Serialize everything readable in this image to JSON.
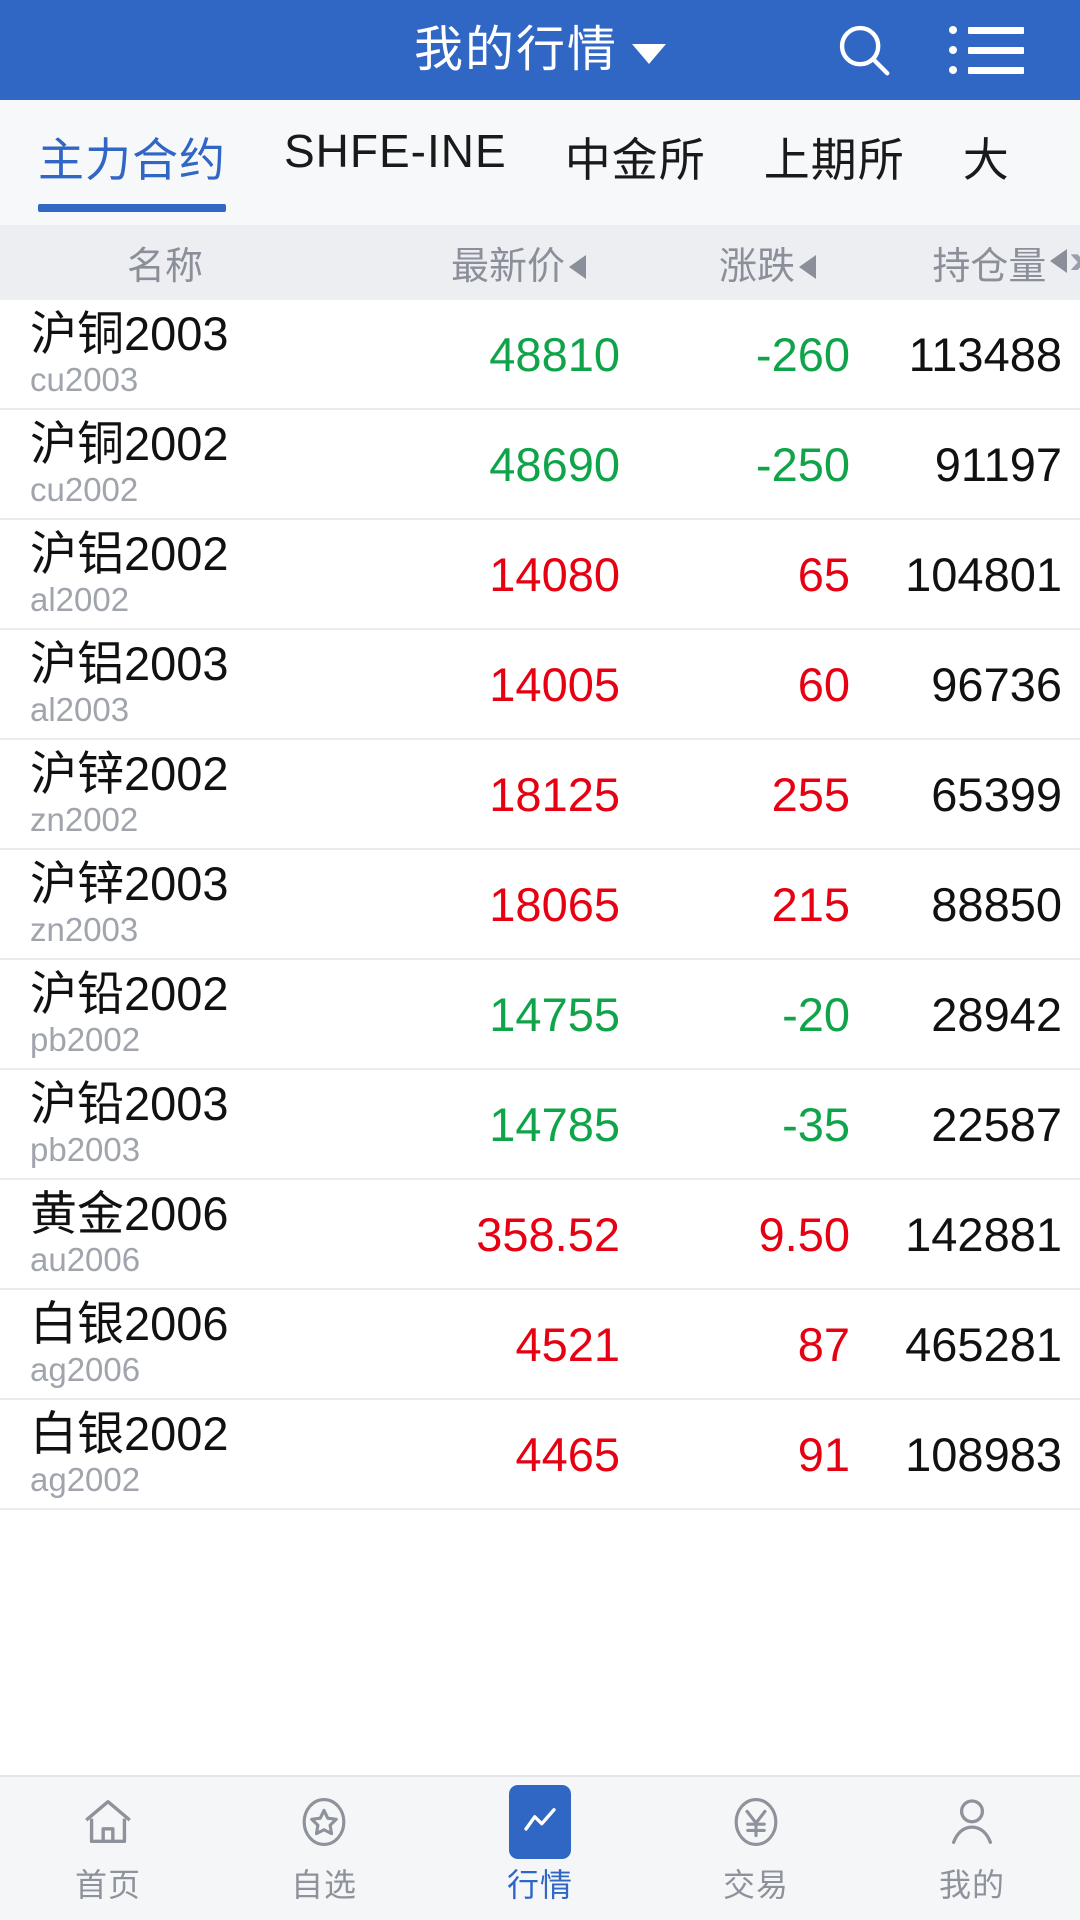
{
  "appbar": {
    "title": "我的行情",
    "caret_icon": "chevron-down-icon",
    "search_icon": "search-icon",
    "menu_icon": "list-menu-icon",
    "bg_color": "#3066C4"
  },
  "tabs": {
    "items": [
      {
        "label": "主力合约",
        "active": true
      },
      {
        "label": "SHFE-INE",
        "active": false
      },
      {
        "label": "中金所",
        "active": false
      },
      {
        "label": "上期所",
        "active": false
      },
      {
        "label": "大",
        "active": false
      }
    ]
  },
  "columns": {
    "name": "名称",
    "price": "最新价",
    "change": "涨跌",
    "open_interest": "持仓量",
    "sort_icon": "sort-triangle-icon",
    "more_icon": "chevron-double-right-icon"
  },
  "colors": {
    "up": "#E60012",
    "down": "#10A44A",
    "neutral": "#111111",
    "accent": "#3066C4"
  },
  "rows": [
    {
      "name": "沪铜2003",
      "code": "cu2003",
      "price": "48810",
      "change": "-260",
      "oi": "113488",
      "dir": "down"
    },
    {
      "name": "沪铜2002",
      "code": "cu2002",
      "price": "48690",
      "change": "-250",
      "oi": "91197",
      "dir": "down"
    },
    {
      "name": "沪铝2002",
      "code": "al2002",
      "price": "14080",
      "change": "65",
      "oi": "104801",
      "dir": "up"
    },
    {
      "name": "沪铝2003",
      "code": "al2003",
      "price": "14005",
      "change": "60",
      "oi": "96736",
      "dir": "up"
    },
    {
      "name": "沪锌2002",
      "code": "zn2002",
      "price": "18125",
      "change": "255",
      "oi": "65399",
      "dir": "up"
    },
    {
      "name": "沪锌2003",
      "code": "zn2003",
      "price": "18065",
      "change": "215",
      "oi": "88850",
      "dir": "up"
    },
    {
      "name": "沪铅2002",
      "code": "pb2002",
      "price": "14755",
      "change": "-20",
      "oi": "28942",
      "dir": "down"
    },
    {
      "name": "沪铅2003",
      "code": "pb2003",
      "price": "14785",
      "change": "-35",
      "oi": "22587",
      "dir": "down"
    },
    {
      "name": "黄金2006",
      "code": "au2006",
      "price": "358.52",
      "change": "9.50",
      "oi": "142881",
      "dir": "up"
    },
    {
      "name": "白银2006",
      "code": "ag2006",
      "price": "4521",
      "change": "87",
      "oi": "465281",
      "dir": "up"
    },
    {
      "name": "白银2002",
      "code": "ag2002",
      "price": "4465",
      "change": "91",
      "oi": "108983",
      "dir": "up"
    }
  ],
  "bottomnav": {
    "items": [
      {
        "label": "首页",
        "icon": "home-icon",
        "active": false
      },
      {
        "label": "自选",
        "icon": "star-icon",
        "active": false
      },
      {
        "label": "行情",
        "icon": "line-chart-icon",
        "active": true
      },
      {
        "label": "交易",
        "icon": "yuan-circle-icon",
        "active": false
      },
      {
        "label": "我的",
        "icon": "person-icon",
        "active": false
      }
    ]
  }
}
